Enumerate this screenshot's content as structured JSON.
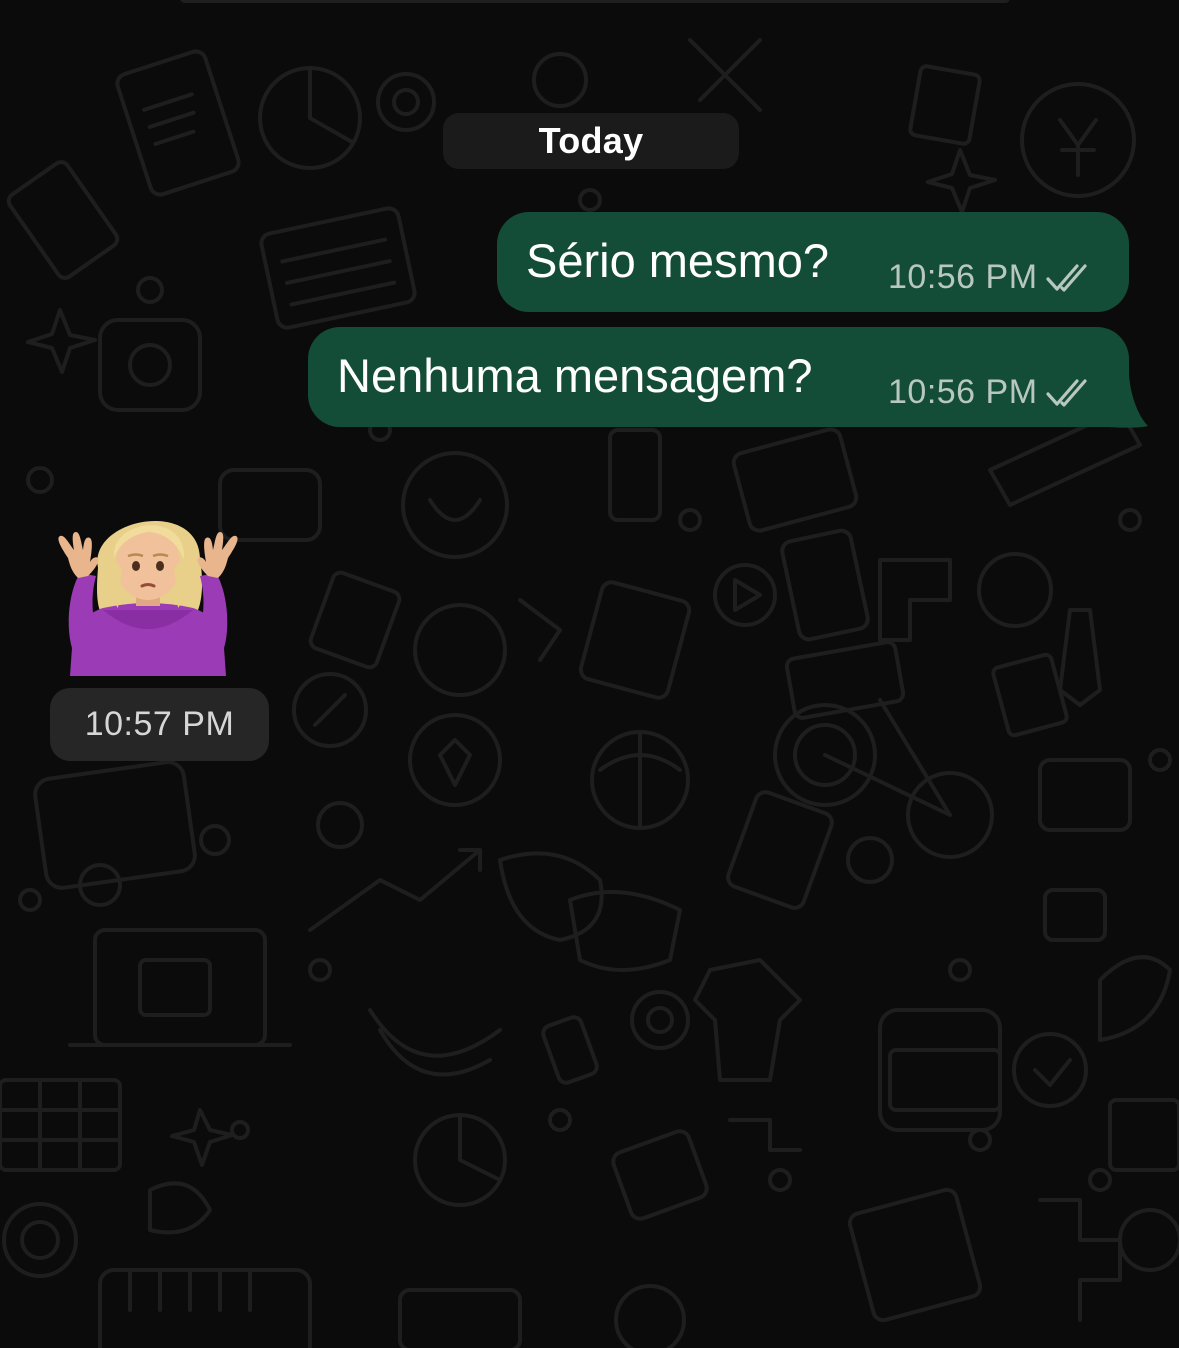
{
  "chat": {
    "date_separator": "Today",
    "messages": [
      {
        "direction": "outgoing",
        "text": "Sério mesmo?",
        "time": "10:56 PM",
        "status": "read"
      },
      {
        "direction": "outgoing",
        "text": "Nenhuma mensagem?",
        "time": "10:56 PM",
        "status": "read"
      },
      {
        "direction": "incoming",
        "type": "sticker",
        "sticker": "person-shrugging-emoji",
        "time": "10:57 PM"
      }
    ]
  },
  "icons": {
    "read_receipt": "double-check-icon",
    "sticker": "person-shrugging-emoji"
  },
  "colors": {
    "background": "#0b0b0b",
    "outgoing_bubble": "#144d37",
    "chip": "#1b1b1b",
    "meta_text": "#b8c7bf"
  }
}
